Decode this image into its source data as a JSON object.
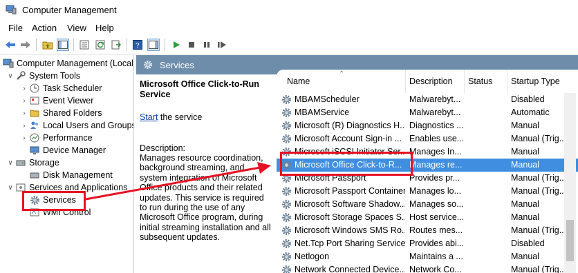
{
  "window": {
    "title": "Computer Management"
  },
  "menu": [
    "File",
    "Action",
    "View",
    "Help"
  ],
  "tree": {
    "root": "Computer Management (Local",
    "system_tools": "System Tools",
    "task_scheduler": "Task Scheduler",
    "event_viewer": "Event Viewer",
    "shared_folders": "Shared Folders",
    "local_users": "Local Users and Groups",
    "performance": "Performance",
    "device_manager": "Device Manager",
    "storage": "Storage",
    "disk_management": "Disk Management",
    "services_apps": "Services and Applications",
    "services": "Services",
    "wmi_control": "WMI Control"
  },
  "services_panel": {
    "header": "Services",
    "selected_name": "Microsoft Office Click-to-Run Service",
    "start_link": "Start",
    "start_suffix": " the service",
    "description_label": "Description:",
    "description": "Manages resource coordination, background streaming, and system integration of Microsoft Office products and their related updates. This service is required to run during the use of any Microsoft Office program, during initial streaming installation and all subsequent updates."
  },
  "columns": {
    "name": "Name",
    "description": "Description",
    "status": "Status",
    "startup": "Startup Type"
  },
  "rows": [
    {
      "name": "MBAMScheduler",
      "description": "Malwarebyt...",
      "status": "",
      "startup": "Disabled"
    },
    {
      "name": "MBAMService",
      "description": "Malwarebyt...",
      "status": "",
      "startup": "Automatic"
    },
    {
      "name": "Microsoft (R) Diagnostics H...",
      "description": "Diagnostics ...",
      "status": "",
      "startup": "Manual"
    },
    {
      "name": "Microsoft Account Sign-in ...",
      "description": "Enables use...",
      "status": "",
      "startup": "Manual (Trig..."
    },
    {
      "name": "Microsoft iSCSI Initiator Ser...",
      "description": "Manages In...",
      "status": "",
      "startup": "Manual"
    },
    {
      "name": "Microsoft Office Click-to-R...",
      "description": "Manages re...",
      "status": "",
      "startup": "Manual"
    },
    {
      "name": "Microsoft Passport",
      "description": "Provides pr...",
      "status": "",
      "startup": "Manual (Trig..."
    },
    {
      "name": "Microsoft Passport Container",
      "description": "Manages lo...",
      "status": "",
      "startup": "Manual (Trig..."
    },
    {
      "name": "Microsoft Software Shadow...",
      "description": "Manages so...",
      "status": "",
      "startup": "Manual"
    },
    {
      "name": "Microsoft Storage Spaces S...",
      "description": "Host service...",
      "status": "",
      "startup": "Manual"
    },
    {
      "name": "Microsoft Windows SMS Ro...",
      "description": "Routes mes...",
      "status": "",
      "startup": "Manual (Trig..."
    },
    {
      "name": "Net.Tcp Port Sharing Service",
      "description": "Provides abi...",
      "status": "",
      "startup": "Disabled"
    },
    {
      "name": "Netlogon",
      "description": "Maintains a ...",
      "status": "",
      "startup": "Manual"
    },
    {
      "name": "Network Connected Device...",
      "description": "Network Co...",
      "status": "",
      "startup": "Manual (Trig..."
    }
  ],
  "selected_row": 5,
  "colors": {
    "header_bg": "#6d8dab",
    "selection": "#3f8ee0",
    "highlight": "#e81123"
  }
}
